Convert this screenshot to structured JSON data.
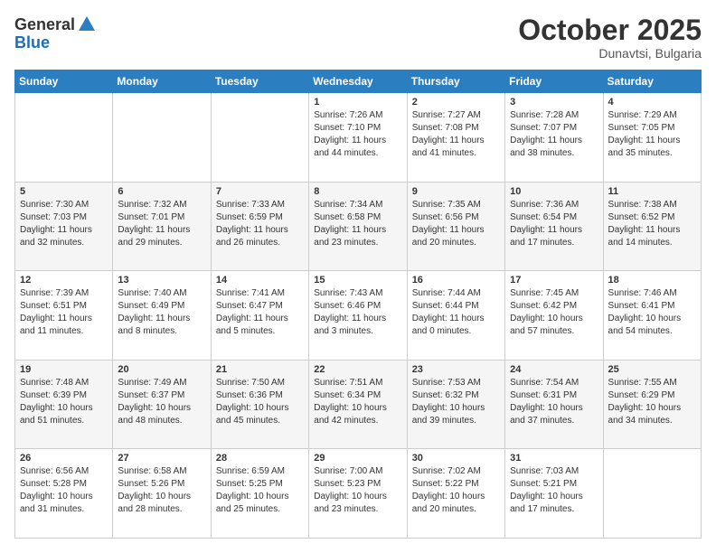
{
  "header": {
    "logo_general": "General",
    "logo_blue": "Blue",
    "month_title": "October 2025",
    "location": "Dunavtsi, Bulgaria"
  },
  "days_of_week": [
    "Sunday",
    "Monday",
    "Tuesday",
    "Wednesday",
    "Thursday",
    "Friday",
    "Saturday"
  ],
  "weeks": [
    [
      {
        "day": "",
        "sunrise": "",
        "sunset": "",
        "daylight": ""
      },
      {
        "day": "",
        "sunrise": "",
        "sunset": "",
        "daylight": ""
      },
      {
        "day": "",
        "sunrise": "",
        "sunset": "",
        "daylight": ""
      },
      {
        "day": "1",
        "sunrise": "Sunrise: 7:26 AM",
        "sunset": "Sunset: 7:10 PM",
        "daylight": "Daylight: 11 hours and 44 minutes."
      },
      {
        "day": "2",
        "sunrise": "Sunrise: 7:27 AM",
        "sunset": "Sunset: 7:08 PM",
        "daylight": "Daylight: 11 hours and 41 minutes."
      },
      {
        "day": "3",
        "sunrise": "Sunrise: 7:28 AM",
        "sunset": "Sunset: 7:07 PM",
        "daylight": "Daylight: 11 hours and 38 minutes."
      },
      {
        "day": "4",
        "sunrise": "Sunrise: 7:29 AM",
        "sunset": "Sunset: 7:05 PM",
        "daylight": "Daylight: 11 hours and 35 minutes."
      }
    ],
    [
      {
        "day": "5",
        "sunrise": "Sunrise: 7:30 AM",
        "sunset": "Sunset: 7:03 PM",
        "daylight": "Daylight: 11 hours and 32 minutes."
      },
      {
        "day": "6",
        "sunrise": "Sunrise: 7:32 AM",
        "sunset": "Sunset: 7:01 PM",
        "daylight": "Daylight: 11 hours and 29 minutes."
      },
      {
        "day": "7",
        "sunrise": "Sunrise: 7:33 AM",
        "sunset": "Sunset: 6:59 PM",
        "daylight": "Daylight: 11 hours and 26 minutes."
      },
      {
        "day": "8",
        "sunrise": "Sunrise: 7:34 AM",
        "sunset": "Sunset: 6:58 PM",
        "daylight": "Daylight: 11 hours and 23 minutes."
      },
      {
        "day": "9",
        "sunrise": "Sunrise: 7:35 AM",
        "sunset": "Sunset: 6:56 PM",
        "daylight": "Daylight: 11 hours and 20 minutes."
      },
      {
        "day": "10",
        "sunrise": "Sunrise: 7:36 AM",
        "sunset": "Sunset: 6:54 PM",
        "daylight": "Daylight: 11 hours and 17 minutes."
      },
      {
        "day": "11",
        "sunrise": "Sunrise: 7:38 AM",
        "sunset": "Sunset: 6:52 PM",
        "daylight": "Daylight: 11 hours and 14 minutes."
      }
    ],
    [
      {
        "day": "12",
        "sunrise": "Sunrise: 7:39 AM",
        "sunset": "Sunset: 6:51 PM",
        "daylight": "Daylight: 11 hours and 11 minutes."
      },
      {
        "day": "13",
        "sunrise": "Sunrise: 7:40 AM",
        "sunset": "Sunset: 6:49 PM",
        "daylight": "Daylight: 11 hours and 8 minutes."
      },
      {
        "day": "14",
        "sunrise": "Sunrise: 7:41 AM",
        "sunset": "Sunset: 6:47 PM",
        "daylight": "Daylight: 11 hours and 5 minutes."
      },
      {
        "day": "15",
        "sunrise": "Sunrise: 7:43 AM",
        "sunset": "Sunset: 6:46 PM",
        "daylight": "Daylight: 11 hours and 3 minutes."
      },
      {
        "day": "16",
        "sunrise": "Sunrise: 7:44 AM",
        "sunset": "Sunset: 6:44 PM",
        "daylight": "Daylight: 11 hours and 0 minutes."
      },
      {
        "day": "17",
        "sunrise": "Sunrise: 7:45 AM",
        "sunset": "Sunset: 6:42 PM",
        "daylight": "Daylight: 10 hours and 57 minutes."
      },
      {
        "day": "18",
        "sunrise": "Sunrise: 7:46 AM",
        "sunset": "Sunset: 6:41 PM",
        "daylight": "Daylight: 10 hours and 54 minutes."
      }
    ],
    [
      {
        "day": "19",
        "sunrise": "Sunrise: 7:48 AM",
        "sunset": "Sunset: 6:39 PM",
        "daylight": "Daylight: 10 hours and 51 minutes."
      },
      {
        "day": "20",
        "sunrise": "Sunrise: 7:49 AM",
        "sunset": "Sunset: 6:37 PM",
        "daylight": "Daylight: 10 hours and 48 minutes."
      },
      {
        "day": "21",
        "sunrise": "Sunrise: 7:50 AM",
        "sunset": "Sunset: 6:36 PM",
        "daylight": "Daylight: 10 hours and 45 minutes."
      },
      {
        "day": "22",
        "sunrise": "Sunrise: 7:51 AM",
        "sunset": "Sunset: 6:34 PM",
        "daylight": "Daylight: 10 hours and 42 minutes."
      },
      {
        "day": "23",
        "sunrise": "Sunrise: 7:53 AM",
        "sunset": "Sunset: 6:32 PM",
        "daylight": "Daylight: 10 hours and 39 minutes."
      },
      {
        "day": "24",
        "sunrise": "Sunrise: 7:54 AM",
        "sunset": "Sunset: 6:31 PM",
        "daylight": "Daylight: 10 hours and 37 minutes."
      },
      {
        "day": "25",
        "sunrise": "Sunrise: 7:55 AM",
        "sunset": "Sunset: 6:29 PM",
        "daylight": "Daylight: 10 hours and 34 minutes."
      }
    ],
    [
      {
        "day": "26",
        "sunrise": "Sunrise: 6:56 AM",
        "sunset": "Sunset: 5:28 PM",
        "daylight": "Daylight: 10 hours and 31 minutes."
      },
      {
        "day": "27",
        "sunrise": "Sunrise: 6:58 AM",
        "sunset": "Sunset: 5:26 PM",
        "daylight": "Daylight: 10 hours and 28 minutes."
      },
      {
        "day": "28",
        "sunrise": "Sunrise: 6:59 AM",
        "sunset": "Sunset: 5:25 PM",
        "daylight": "Daylight: 10 hours and 25 minutes."
      },
      {
        "day": "29",
        "sunrise": "Sunrise: 7:00 AM",
        "sunset": "Sunset: 5:23 PM",
        "daylight": "Daylight: 10 hours and 23 minutes."
      },
      {
        "day": "30",
        "sunrise": "Sunrise: 7:02 AM",
        "sunset": "Sunset: 5:22 PM",
        "daylight": "Daylight: 10 hours and 20 minutes."
      },
      {
        "day": "31",
        "sunrise": "Sunrise: 7:03 AM",
        "sunset": "Sunset: 5:21 PM",
        "daylight": "Daylight: 10 hours and 17 minutes."
      },
      {
        "day": "",
        "sunrise": "",
        "sunset": "",
        "daylight": ""
      }
    ]
  ]
}
